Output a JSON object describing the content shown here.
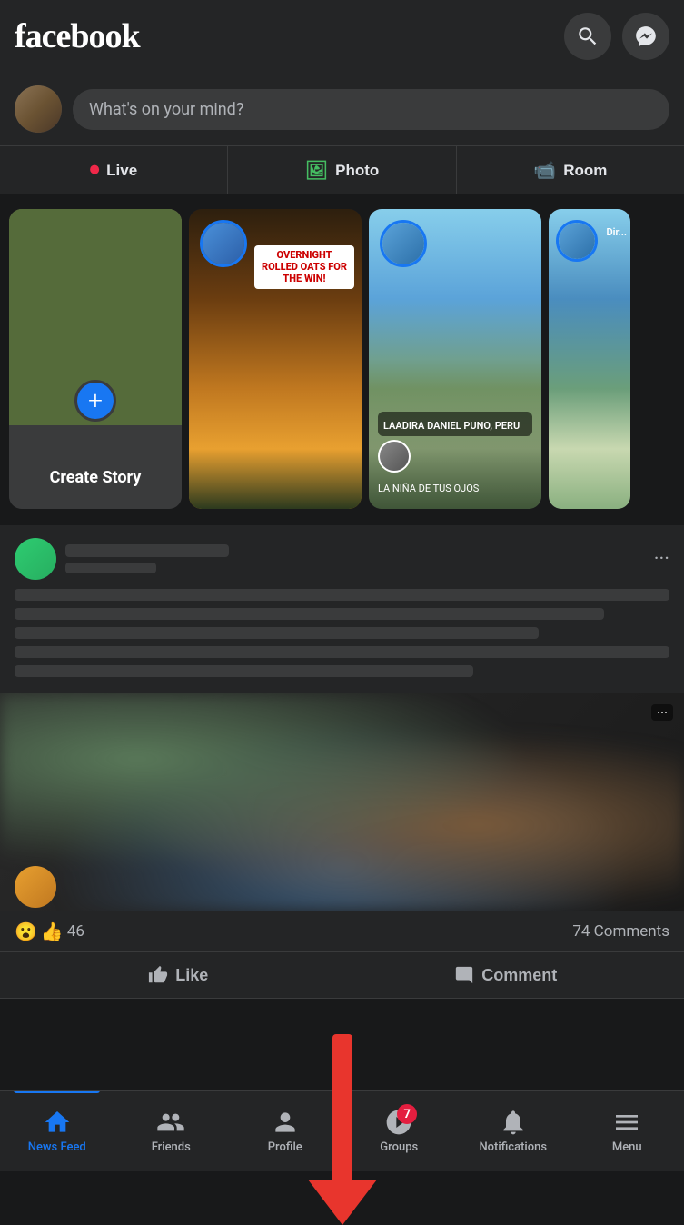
{
  "app": {
    "logo": "facebook",
    "search_icon": "search",
    "messenger_icon": "messenger"
  },
  "composer": {
    "placeholder": "What's on your mind?"
  },
  "action_bar": {
    "live_label": "Live",
    "photo_label": "Photo",
    "room_label": "Room"
  },
  "stories": [
    {
      "id": "create",
      "label": "Create Story",
      "type": "create"
    },
    {
      "id": "story2",
      "label": "",
      "type": "food"
    },
    {
      "id": "story3",
      "label": "LAADIRA DANIEL PUNO, PERU",
      "type": "landscape"
    },
    {
      "id": "story4",
      "label": "Dir...",
      "type": "side"
    }
  ],
  "story_banner": "OVERNIGHT ROLLED OATS FOR THE WIN!",
  "post": {
    "reactions_count": "46",
    "comments_count": "74 Comments",
    "like_label": "Like",
    "comment_label": "Comment"
  },
  "bottom_nav": {
    "news_feed": "News Feed",
    "friends": "Friends",
    "profile": "Profile",
    "groups": "Groups",
    "notifications": "Notifications",
    "menu": "Menu",
    "groups_badge": "7"
  }
}
